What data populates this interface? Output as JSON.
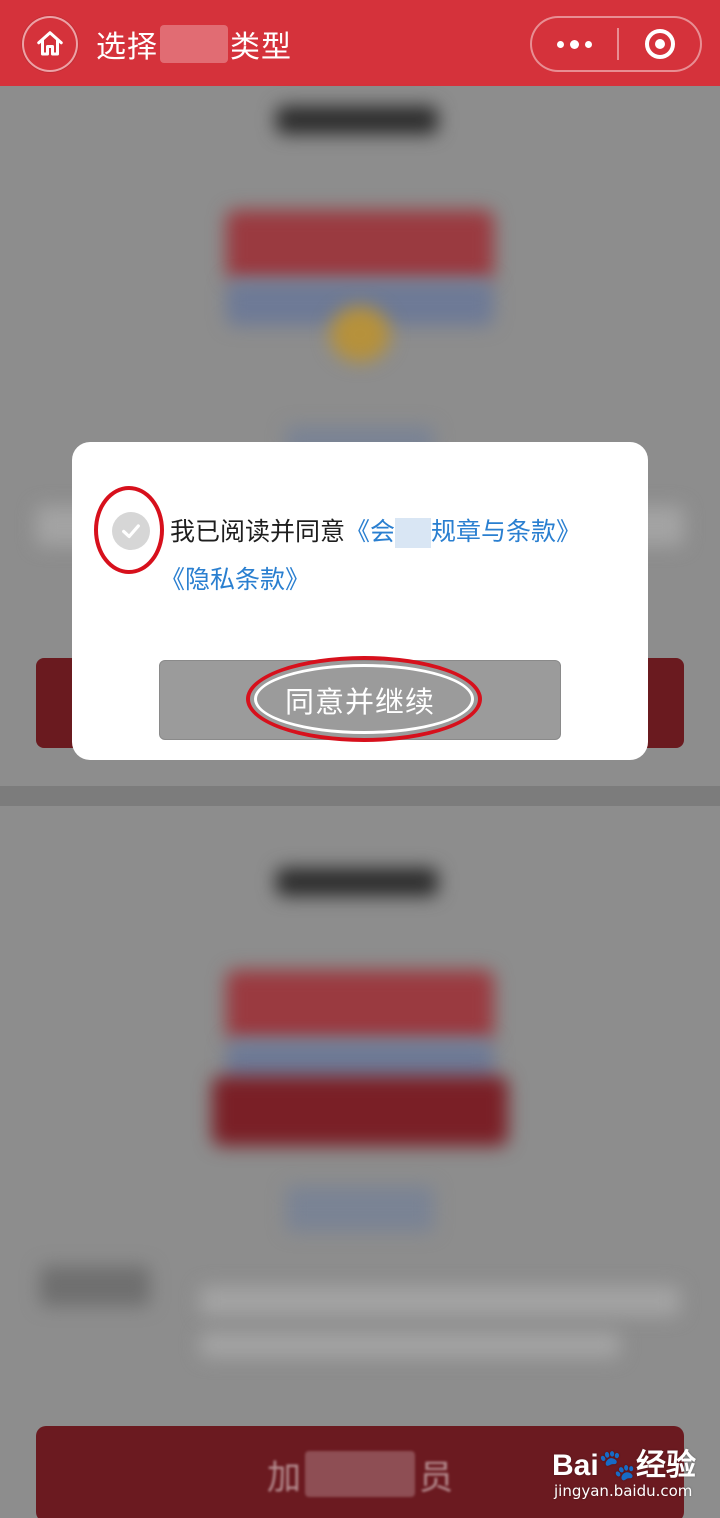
{
  "navbar": {
    "title_before": "选择",
    "title_after": "类型",
    "home_icon": "home-icon",
    "more_icon": "more-dots-icon",
    "close_icon": "target-close-icon"
  },
  "modal": {
    "agree_prefix": "我已阅读并同意",
    "terms_link_start": "《会",
    "terms_link_end": "规章与条款》",
    "privacy_link": "《隐私条款》",
    "checkbox_state": "checked",
    "continue_label": "同意并继续"
  },
  "background": {
    "bottom_button_start": "加",
    "bottom_button_end": "员"
  },
  "watermark": {
    "brand": "Bai🐾经验",
    "url": "jingyan.baidu.com"
  },
  "colors": {
    "brand_red": "#d5323b",
    "link_blue": "#2a7fd0",
    "highlight_red": "#d7101c",
    "button_gray": "#9b9b9b"
  }
}
